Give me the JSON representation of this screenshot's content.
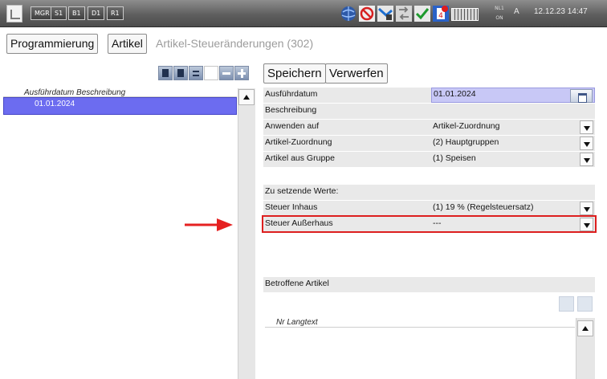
{
  "topbar": {
    "buttons": [
      "MGR",
      "S1",
      "B1",
      "D1",
      "R1"
    ],
    "status_icons": [
      "globe-icon",
      "no-entry-icon",
      "network-icon",
      "transfer-icon",
      "checkmark-icon",
      "alert-icon",
      "keyboard-icon"
    ],
    "alert_badge": "4",
    "nl_label": "NL1",
    "nl_state": "ON",
    "a_indicator": "A",
    "datetime": "12.12.23 14:47"
  },
  "breadcrumb": [
    "Programmierung",
    "Artikel",
    "Artikel-Steueränderungen (302)"
  ],
  "list_toolbar": [
    "move-down-icon",
    "move-up-icon",
    "list-icon",
    "new-document-icon",
    "remove-icon",
    "add-icon"
  ],
  "left_list": {
    "header": "Ausführdatum Beschreibung",
    "rows": [
      {
        "date": "01.01.2024",
        "desc": ""
      }
    ]
  },
  "actions": {
    "save": "Speichern",
    "discard": "Verwerfen"
  },
  "form": {
    "fields": [
      {
        "label": "Ausführdatum",
        "value": "01.01.2024"
      },
      {
        "label": "Beschreibung",
        "value": ""
      },
      {
        "label": "Anwenden auf",
        "value": "Artikel-Zuordnung"
      },
      {
        "label": "Artikel-Zuordnung",
        "value": "(2) Hauptgruppen"
      },
      {
        "label": "Artikel aus Gruppe",
        "value": "(1) Speisen"
      }
    ],
    "section_label": "Zu setzende Werte:",
    "tax_fields": [
      {
        "label": "Steuer Inhaus",
        "value": "(1) 19 % (Regelsteuersatz)"
      },
      {
        "label": "Steuer Außerhaus",
        "value": "---"
      }
    ],
    "affected_label": "Betroffene Artikel"
  },
  "affected_list": {
    "header": "Nr Langtext"
  },
  "colors": {
    "highlight": "#dd1f1f",
    "arrow": "#e52121",
    "selected_row": "#6c6cf0",
    "date_field": "#c8c8f6"
  }
}
